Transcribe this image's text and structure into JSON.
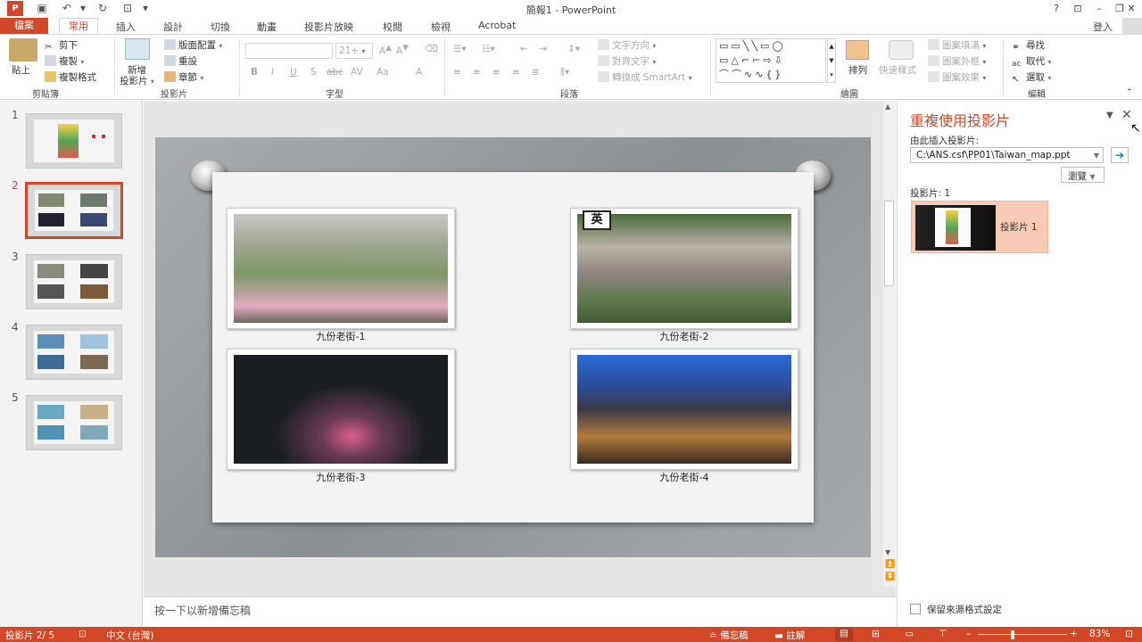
{
  "title_bar": {
    "title": "簡報1 - PowerPoint",
    "help": "?",
    "signin": "登入"
  },
  "tabs": [
    "檔案",
    "常用",
    "插入",
    "設計",
    "切換",
    "動畫",
    "投影片放映",
    "校閱",
    "檢視",
    "Acrobat"
  ],
  "ribbon": {
    "clipboard": {
      "paste": "貼上",
      "cut": "剪下",
      "copy": "複製",
      "format_painter": "複製格式",
      "label": "剪貼簿"
    },
    "slides": {
      "new_slide_1": "新增",
      "new_slide_2": "投影片",
      "layout": "版面配置",
      "reset": "重設",
      "section": "章節",
      "label": "投影片"
    },
    "font": {
      "size": "21+",
      "bold": "B",
      "italic": "I",
      "underline": "U",
      "shadow": "S",
      "strike": "abc",
      "spacing": "AV",
      "case": "Aa",
      "label": "字型"
    },
    "paragraph": {
      "text_direction": "文字方向",
      "align_text": "對齊文字",
      "smartart": "轉換成 SmartArt",
      "label": "段落"
    },
    "drawing": {
      "arrange": "排列",
      "quick_styles": "快速樣式",
      "fill": "圖案填滿",
      "outline": "圖案外框",
      "effects": "圖案效果",
      "label": "繪圖"
    },
    "editing": {
      "find": "尋找",
      "replace": "取代",
      "select": "選取",
      "label": "編輯"
    }
  },
  "slides": [
    {
      "num": "1",
      "theme": "map"
    },
    {
      "num": "2",
      "theme": "photos"
    },
    {
      "num": "3",
      "theme": "photos"
    },
    {
      "num": "4",
      "theme": "sea"
    },
    {
      "num": "5",
      "theme": "beach"
    }
  ],
  "selected_slide": "2",
  "slide_content": {
    "ime_badge": "英",
    "captions": [
      "九份老街-1",
      "九份老街-2",
      "九份老街-3",
      "九份老街-4"
    ]
  },
  "notes_placeholder": "按一下以新增備忘稿",
  "reuse_pane": {
    "title": "重複使用投影片",
    "insert_from_label": "由此插入投影片:",
    "path_value": "C:\\ANS.csf\\PP01\\Taiwan_map.ppt",
    "browse": "瀏覽",
    "slides_label": "投影片: 1",
    "item_label": "投影片 1",
    "keep_format": "保留來源格式設定"
  },
  "status_bar": {
    "slide_pos": "投影片 2/ 5",
    "language": "中文 (台灣)",
    "notes": "備忘稿",
    "comments": "註解",
    "zoom": "83%"
  },
  "colors": {
    "accent": "#d24726",
    "pane_selected": "#f9cbb6"
  }
}
